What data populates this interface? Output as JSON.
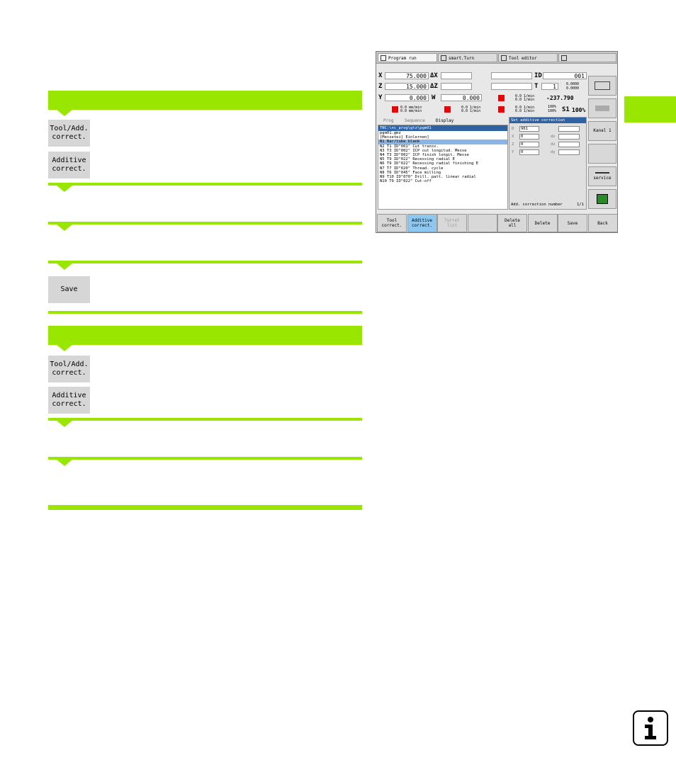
{
  "doc": {
    "softkeys": {
      "tool_add_correct": "Tool/Add.\ncorrect.",
      "additive_correct": "Additive\ncorrect.",
      "save": "Save"
    },
    "info_icon": "info-icon"
  },
  "screen": {
    "tabs": [
      "Program run",
      "smart.Turn",
      "Tool editor",
      ""
    ],
    "dro": {
      "x_label": "X",
      "x_value": "75.000",
      "dx_label": "ΔX",
      "z_label": "Z",
      "z_value": "15.000",
      "dz_label": "ΔZ",
      "y_label": "Y",
      "y_value": "0.000",
      "w_label": "W",
      "w_value": "0.000",
      "id_label": "ID",
      "id_value": "001",
      "t_label": "T",
      "t_value": "1",
      "x_off": "0.0000",
      "z_off": "0.0000",
      "angle": "-237.790",
      "feed_1": "0.0 mm/min",
      "feed_2": "0.0 mm/min",
      "rpm_1": "0.0 1/min",
      "rpm_2": "0.0 1/min",
      "rpm_3": "0.0 1/min",
      "rpm_4": "0.0 1/min",
      "rpm_5": "0.0 1/min",
      "rpm_6": "0.0 1/min",
      "f_override": "100%",
      "r_override": "100%",
      "s1_label": "S1",
      "s1_override": "100%"
    },
    "view_tabs": [
      "Prog",
      "Sequence",
      "Display"
    ],
    "program": {
      "path": "TNC:\\nc_prog\\gtz\\pgm01",
      "lines": [
        "pgm01.gmz",
        "[Messetei] Einlernen]",
        "N1 Bar/tube blank",
        "N2 T1 ID\"001\" Cut transv.",
        "N3 T3 ID\"002\" ICP cut longitud. Messe",
        "N4 T3 ID\"002\" ICP finish longit. Messe",
        "N5 T9 ID\"022\" Recessing radial E",
        "N6 T9 ID\"022\" Recessing radial finishing E",
        "N7 T7 ID\"020\" Thread. cycle",
        "N8 T6 ID\"045\" Face milling",
        "N9 T10 ID\"070\" Drill. patt. linear radial",
        "N10 T9 ID\"022\" Cut-off"
      ],
      "selected_index": 2
    },
    "dialog": {
      "title": "Set additive correction",
      "fields": [
        {
          "label": "D",
          "value": "901",
          "label2": "",
          "value2": ""
        },
        {
          "label": "X",
          "value": "0",
          "label2": "dx",
          "value2": ""
        },
        {
          "label": "Z",
          "value": "0",
          "label2": "dz",
          "value2": ""
        },
        {
          "label": "Y",
          "value": "0",
          "label2": "dy",
          "value2": ""
        }
      ],
      "status": "Add. correction number",
      "page": "1/1"
    },
    "side_buttons": [
      "",
      "",
      "Kanal 1",
      "",
      "service",
      ""
    ],
    "bottom_buttons": [
      {
        "label": "Tool\ncorrect.",
        "state": "normal"
      },
      {
        "label": "Additive\ncorrect.",
        "state": "active"
      },
      {
        "label": "Turret\nlist",
        "state": "disabled"
      },
      {
        "label": "",
        "state": "normal"
      },
      {
        "label": "Delete\nall",
        "state": "normal"
      },
      {
        "label": "Delete",
        "state": "normal"
      },
      {
        "label": "Save",
        "state": "normal"
      },
      {
        "label": "Back",
        "state": "normal"
      }
    ]
  }
}
